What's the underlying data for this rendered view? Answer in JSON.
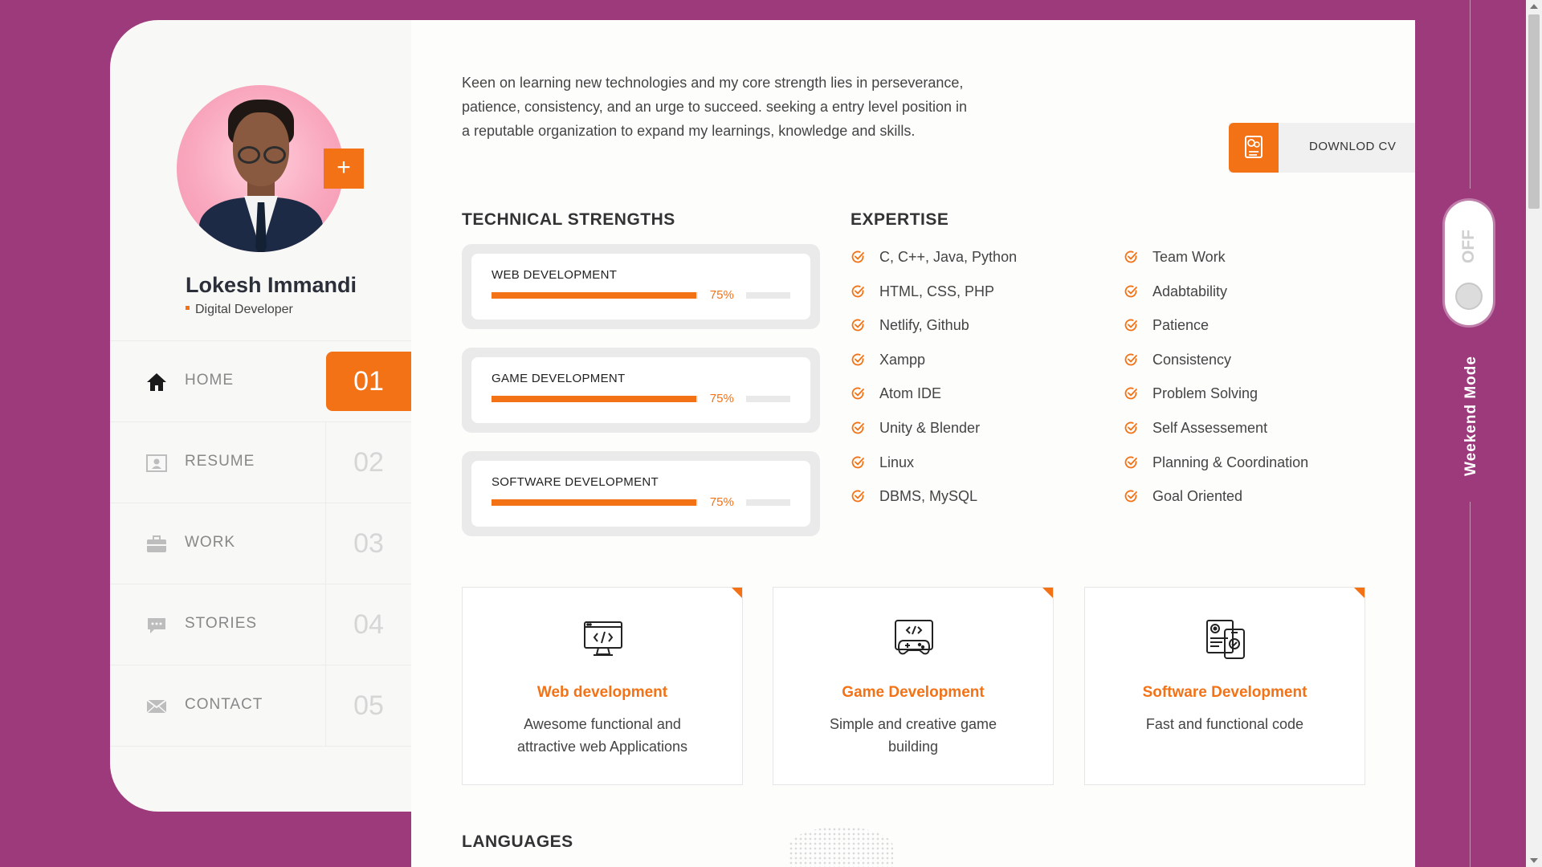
{
  "profile": {
    "name": "Lokesh Immandi",
    "role": "Digital Developer",
    "plus_label": "+"
  },
  "nav": [
    {
      "label": "HOME",
      "number": "01",
      "icon": "home-icon",
      "active": true
    },
    {
      "label": "RESUME",
      "number": "02",
      "icon": "id-card-icon",
      "active": false
    },
    {
      "label": "WORK",
      "number": "03",
      "icon": "briefcase-icon",
      "active": false
    },
    {
      "label": "STORIES",
      "number": "04",
      "icon": "chat-icon",
      "active": false
    },
    {
      "label": "CONTACT",
      "number": "05",
      "icon": "envelope-icon",
      "active": false
    }
  ],
  "intro": "Keen on learning new technologies and my core strength lies in perseverance, patience, consistency, and an urge to succeed. seeking a entry level position in a reputable organization to expand my learnings, knowledge and skills.",
  "download_cv": {
    "label": "DOWNLOD CV",
    "icon": "cv-document-icon"
  },
  "technical_strengths": {
    "heading": "TECHNICAL STRENGTHS",
    "skills": [
      {
        "label": "WEB DEVELOPMENT",
        "percent_label": "75%",
        "percent": 75
      },
      {
        "label": "GAME DEVELOPMENT",
        "percent_label": "75%",
        "percent": 75
      },
      {
        "label": "SOFTWARE DEVELOPMENT",
        "percent_label": "75%",
        "percent": 75
      }
    ]
  },
  "expertise": {
    "heading": "EXPERTISE",
    "column1": [
      "C, C++, Java, Python",
      "HTML, CSS, PHP",
      "Netlify, Github",
      "Xampp",
      "Atom IDE",
      "Unity & Blender",
      "Linux",
      "DBMS, MySQL"
    ],
    "column2": [
      "Team Work",
      "Adabtability",
      "Patience",
      "Consistency",
      "Problem Solving",
      "Self Assessement",
      "Planning & Coordination",
      "Goal Oriented"
    ]
  },
  "services": [
    {
      "title": "Web development",
      "description": "Awesome functional and attractive web Applications",
      "icon": "monitor-code-icon"
    },
    {
      "title": "Game Development",
      "description": "Simple and creative game building",
      "icon": "gamepad-code-icon"
    },
    {
      "title": "Software Development",
      "description": "Fast and functional code",
      "icon": "software-settings-icon"
    }
  ],
  "languages": {
    "heading": "LANGUAGES"
  },
  "weekend_mode": {
    "label": "Weekend Mode",
    "state": "OFF"
  },
  "colors": {
    "accent": "#f47216",
    "background": "#9c3a7c",
    "panel": "#f8f8f6"
  }
}
